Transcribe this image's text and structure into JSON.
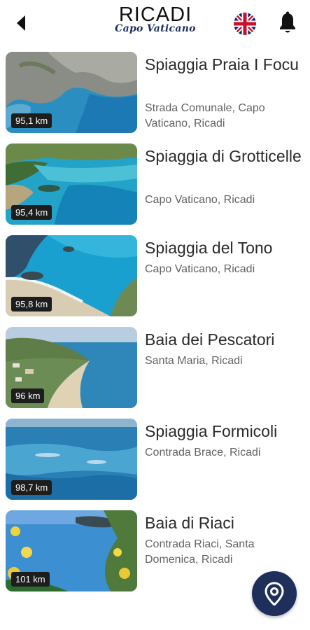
{
  "header": {
    "brand_title": "RICADI",
    "brand_subtitle": "Capo Vaticano",
    "back_icon": "arrow-left-icon",
    "language_icon": "uk-flag-icon",
    "notification_icon": "bell-icon"
  },
  "beaches": [
    {
      "title": "Spiaggia Praia I Focu",
      "address": "Strada Comunale, Capo Vaticano, Ricadi",
      "distance": "95,1 km"
    },
    {
      "title": "Spiaggia di Grotticelle",
      "address": "Capo Vaticano, Ricadi",
      "distance": "95,4 km"
    },
    {
      "title": "Spiaggia del Tono",
      "address": "Capo Vaticano, Ricadi",
      "distance": "95,8 km"
    },
    {
      "title": "Baia dei Pescatori",
      "address": "Santa Maria, Ricadi",
      "distance": "96 km"
    },
    {
      "title": "Spiaggia Formicoli",
      "address": "Contrada Brace, Ricadi",
      "distance": "98,7 km"
    },
    {
      "title": "Baia di Riaci",
      "address": "Contrada Riaci, Santa Domenica, Ricadi",
      "distance": "101 km"
    }
  ],
  "fab": {
    "icon": "map-pin-icon"
  },
  "colors": {
    "brand_navy": "#1f2f5c",
    "badge_bg": "#1d1d1d",
    "sea": "#1f8fc4"
  }
}
